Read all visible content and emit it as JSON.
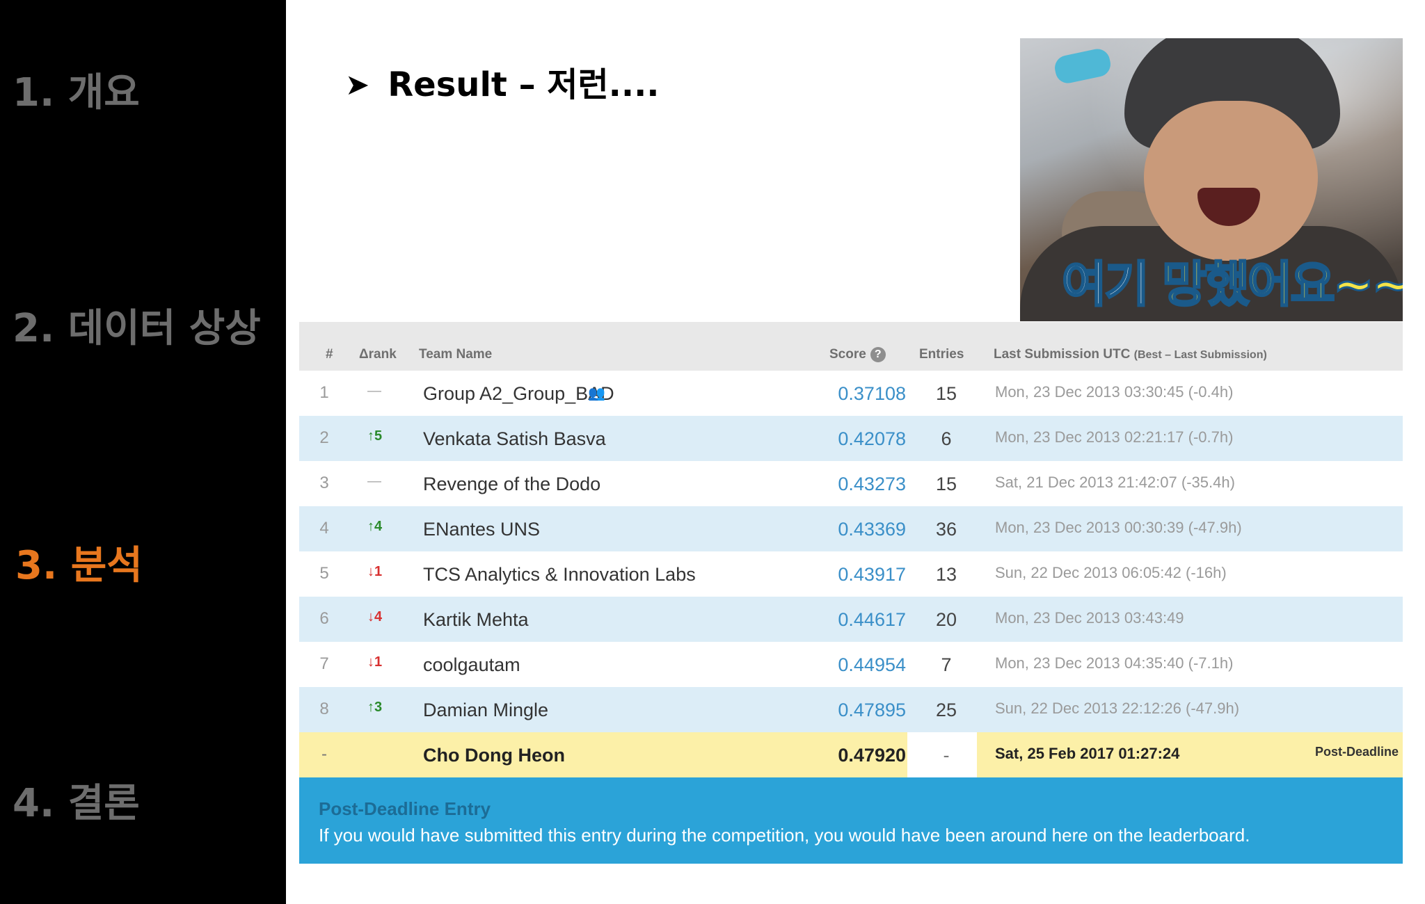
{
  "sidebar": {
    "sections": [
      {
        "label": "1. 개요",
        "active": false
      },
      {
        "label": "2. 데이터 상상",
        "active": false
      },
      {
        "label": "3. 분석",
        "active": true
      },
      {
        "label": "4. 결론",
        "active": false
      }
    ]
  },
  "slide": {
    "title": "Result – 저런....",
    "arrow_icon": "arrow-bullet-icon",
    "meme_caption_white": "여기 ",
    "meme_caption_yellow": "망했어요~~"
  },
  "leaderboard": {
    "headers": {
      "rank": "#",
      "delta": "Δrank",
      "team": "Team Name",
      "score": "Score",
      "entries": "Entries",
      "last": "Last Submission UTC",
      "last_note": "(Best – Last Submission)"
    },
    "rows": [
      {
        "rank": "1",
        "delta": "—",
        "dir": "none",
        "team": "Group A2_Group_BAD",
        "score": "0.37108",
        "entries": "15",
        "last": "Mon, 23 Dec 2013 03:30:45 (-0.4h)"
      },
      {
        "rank": "2",
        "delta": "↑5",
        "dir": "up",
        "team": "Venkata Satish Basva",
        "score": "0.42078",
        "entries": "6",
        "last": "Mon, 23 Dec 2013 02:21:17 (-0.7h)"
      },
      {
        "rank": "3",
        "delta": "—",
        "dir": "none",
        "team": "Revenge of the Dodo",
        "score": "0.43273",
        "entries": "15",
        "last": "Sat, 21 Dec 2013 21:42:07 (-35.4h)"
      },
      {
        "rank": "4",
        "delta": "↑4",
        "dir": "up",
        "team": "ENantes UNS",
        "score": "0.43369",
        "entries": "36",
        "last": "Mon, 23 Dec 2013 00:30:39 (-47.9h)"
      },
      {
        "rank": "5",
        "delta": "↓1",
        "dir": "down",
        "team": "TCS Analytics & Innovation Labs",
        "score": "0.43917",
        "entries": "13",
        "last": "Sun, 22 Dec 2013 06:05:42 (-16h)"
      },
      {
        "rank": "6",
        "delta": "↓4",
        "dir": "down",
        "team": "Kartik Mehta",
        "score": "0.44617",
        "entries": "20",
        "last": "Mon, 23 Dec 2013 03:43:49"
      },
      {
        "rank": "7",
        "delta": "↓1",
        "dir": "down",
        "team": "coolgautam",
        "score": "0.44954",
        "entries": "7",
        "last": "Mon, 23 Dec 2013 04:35:40 (-7.1h)"
      },
      {
        "rank": "8",
        "delta": "↑3",
        "dir": "up",
        "team": "Damian Mingle",
        "score": "0.47895",
        "entries": "25",
        "last": "Sun, 22 Dec 2013 22:12:26 (-47.9h)"
      }
    ],
    "my_entry": {
      "rank": "-",
      "team": "Cho Dong Heon",
      "score": "0.47920",
      "entries": "-",
      "last": "Sat, 25 Feb 2017 01:27:24",
      "tag": "Post-Deadline"
    },
    "notice": {
      "title": "Post-Deadline Entry",
      "text": "If you would have submitted this entry during the competition, you would have been around here on the leaderboard."
    }
  },
  "colors": {
    "sidebar_bg": "#000000",
    "inactive_section": "#6d6d6d",
    "active_section": "#e8771e",
    "score_link": "#3a8fc8",
    "my_entry_bg": "#fcf0a8",
    "notice_bg": "#2ba3d8"
  }
}
